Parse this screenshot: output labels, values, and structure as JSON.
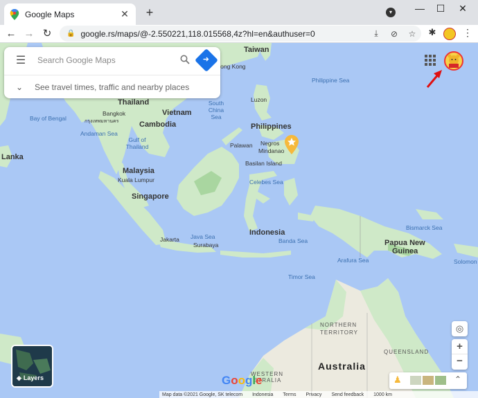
{
  "browser": {
    "tab_title": "Google Maps",
    "url": "google.rs/maps/@-2.550221,118.015568,4z?hl=en&authuser=0"
  },
  "search": {
    "placeholder": "Search Google Maps",
    "travel_hint": "See travel times, traffic and nearby places"
  },
  "map_labels": {
    "taiwan": "Taiwan",
    "hong_kong": "Hong Kong",
    "philippine_sea": "Philippine Sea",
    "thailand": "Thailand",
    "vietnam": "Vietnam",
    "south_china_sea": "South China Sea",
    "luzon": "Luzon",
    "bangkok": "Bangkok",
    "bangkok_thai": "กรุงเทพมหานคร",
    "bay_of_bengal": "Bay of Bengal",
    "cambodia": "Cambodia",
    "philippines": "Philippines",
    "andaman_sea": "Andaman Sea",
    "gulf_of_thailand": "Gulf of Thailand",
    "palawan": "Palawan",
    "negros": "Negros",
    "mindanao": "Mindanao",
    "lanka": "Lanka",
    "basilan_island": "Basilan Island",
    "malaysia": "Malaysia",
    "kuala_lumpur": "Kuala Lumpur",
    "celebes_sea": "Celebes Sea",
    "singapore": "Singapore",
    "indonesia": "Indonesia",
    "bismarck_sea": "Bismarck Sea",
    "java_sea": "Java Sea",
    "banda_sea": "Banda Sea",
    "papua_new_guinea_1": "Papua New",
    "papua_new_guinea_2": "Guinea",
    "jakarta": "Jakarta",
    "surabaya": "Surabaya",
    "arafura_sea": "Arafura Sea",
    "solomon": "Solomon",
    "timor_sea": "Timor Sea",
    "northern_territory_1": "NORTHERN",
    "northern_territory_2": "TERRITORY",
    "australia": "Australia",
    "queensland": "QUEENSLAND",
    "western_australia_1": "WESTERN",
    "western_australia_2": "STRALIA"
  },
  "controls": {
    "layers_label": "Layers",
    "zoom_in": "+",
    "zoom_out": "−",
    "expand": "≈"
  },
  "footer": {
    "map_data": "Map data ©2021 Google, SK telecom",
    "indonesia": "Indonesia",
    "terms": "Terms",
    "privacy": "Privacy",
    "feedback": "Send feedback",
    "scale": "1000 km"
  },
  "colors": {
    "water": "#aac8f5",
    "land": "#cfe9c8",
    "land_dark": "#a9d6a0",
    "desert": "#eceadf",
    "accent": "#1a73e8"
  }
}
